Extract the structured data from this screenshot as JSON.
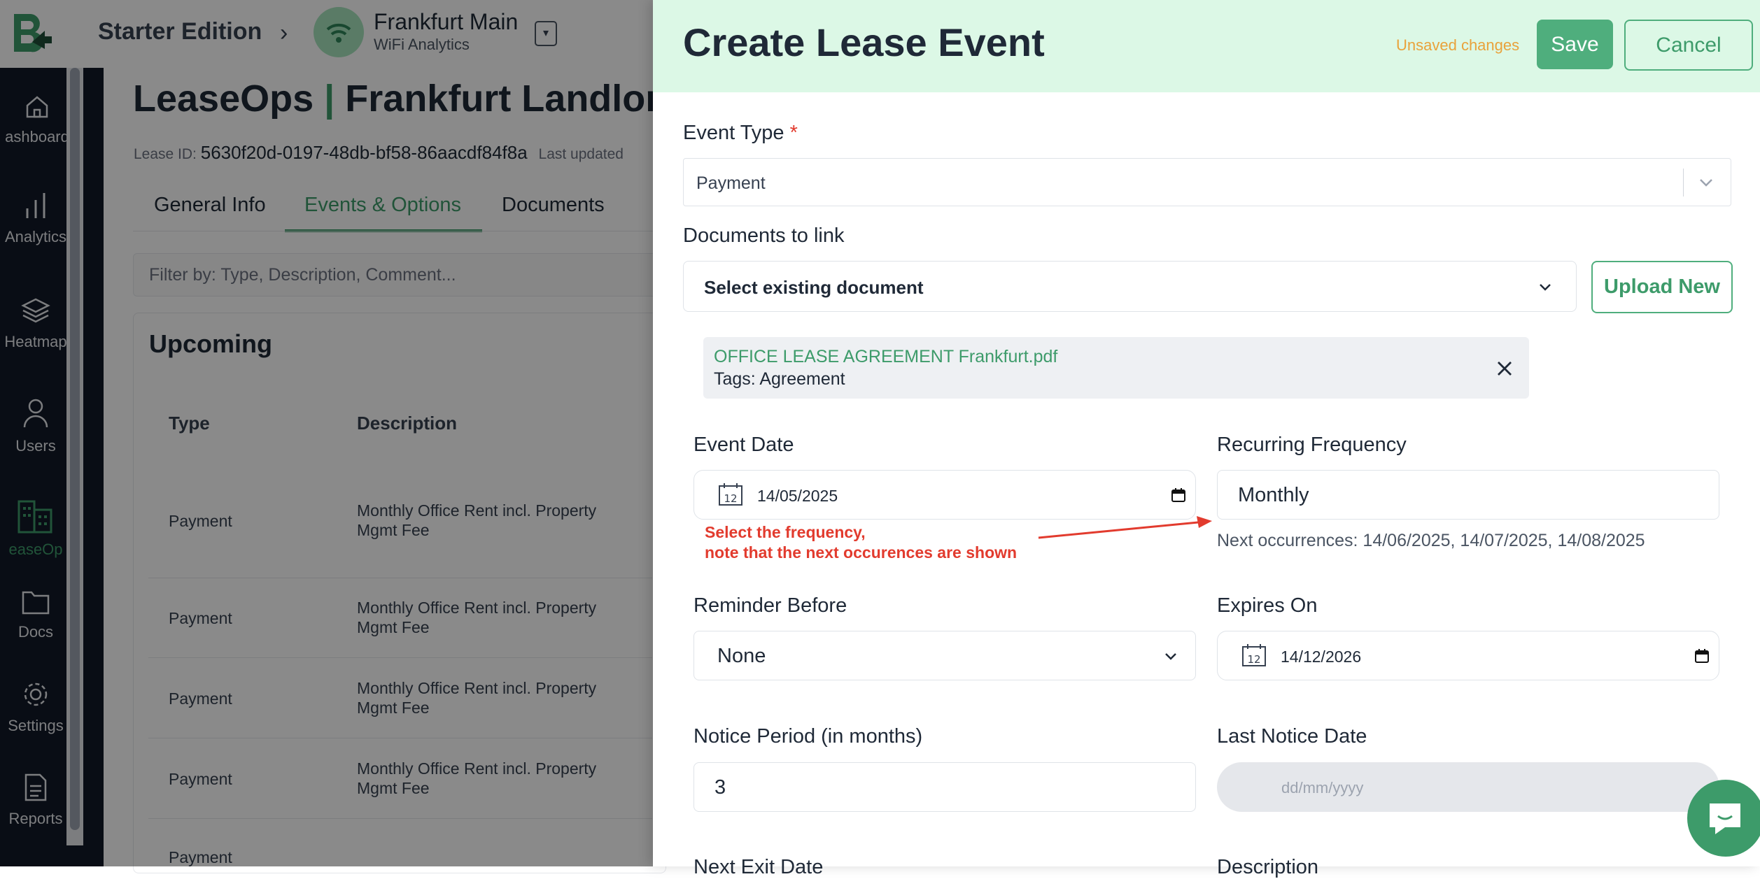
{
  "app": {
    "edition": "Starter Edition",
    "site_name": "Frankfurt Main",
    "site_subtitle": "WiFi Analytics"
  },
  "sidebar": {
    "items": [
      {
        "label": "ashboard",
        "icon": "home-icon"
      },
      {
        "label": "Analytics",
        "icon": "bar-chart-icon"
      },
      {
        "label": "Heatmap",
        "icon": "layers-icon"
      },
      {
        "label": "Users",
        "icon": "user-icon"
      },
      {
        "label": "easeOp",
        "icon": "building-icon"
      },
      {
        "label": "Docs",
        "icon": "folder-icon"
      },
      {
        "label": "Settings",
        "icon": "gear-icon"
      },
      {
        "label": "Reports",
        "icon": "document-icon"
      }
    ]
  },
  "page": {
    "title_prefix": "LeaseOps",
    "title_divider": "|",
    "title_suffix": "Frankfurt Landlord",
    "lease_id_label": "Lease ID:",
    "lease_id_value": "5630f20d-0197-48db-bf58-86aacdf84f8a",
    "last_updated_label": "Last updated",
    "tabs": [
      "General Info",
      "Events & Options",
      "Documents"
    ],
    "filter_placeholder": "Filter by: Type, Description, Comment...",
    "section_title": "Upcoming",
    "table": {
      "headers": [
        "Type",
        "Description"
      ],
      "rows": [
        {
          "type": "Payment",
          "description": "Monthly Office Rent incl. Property Mgmt Fee"
        },
        {
          "type": "Payment",
          "description": "Monthly Office Rent incl. Property Mgmt Fee"
        },
        {
          "type": "Payment",
          "description": "Monthly Office Rent incl. Property Mgmt Fee"
        },
        {
          "type": "Payment",
          "description": "Monthly Office Rent incl. Property Mgmt Fee"
        },
        {
          "type": "Payment",
          "description": ""
        }
      ]
    }
  },
  "modal": {
    "title": "Create Lease Event",
    "unsaved": "Unsaved changes",
    "save_label": "Save",
    "cancel_label": "Cancel",
    "event_type_label": "Event Type",
    "required_mark": "*",
    "event_type_value": "Payment",
    "documents_label": "Documents to link",
    "documents_select": "Select existing document",
    "upload_label": "Upload New",
    "linked_doc_name": "OFFICE LEASE AGREEMENT Frankfurt.pdf",
    "linked_doc_tags": "Tags: Agreement",
    "event_date_label": "Event Date",
    "event_date_value": "14/05/2025",
    "recurring_label": "Recurring Frequency",
    "recurring_value": "Monthly",
    "next_occurrences": "Next occurrences: 14/06/2025, 14/07/2025, 14/08/2025",
    "annotation_line1": "Select the frequency,",
    "annotation_line2": "note that the next occurences are shown",
    "reminder_label": "Reminder Before",
    "reminder_value": "None",
    "expires_label": "Expires On",
    "expires_value": "14/12/2026",
    "notice_label": "Notice Period (in months)",
    "notice_value": "3",
    "last_notice_label": "Last Notice Date",
    "last_notice_placeholder": "dd/mm/yyyy",
    "next_exit_label": "Next Exit Date",
    "description_label": "Description",
    "calendar_day": "12"
  },
  "colors": {
    "brand_green": "#3d9b6a",
    "header_bg": "#dcf8e6",
    "unsaved": "#e9a23b",
    "annotation": "#e23b2e"
  }
}
